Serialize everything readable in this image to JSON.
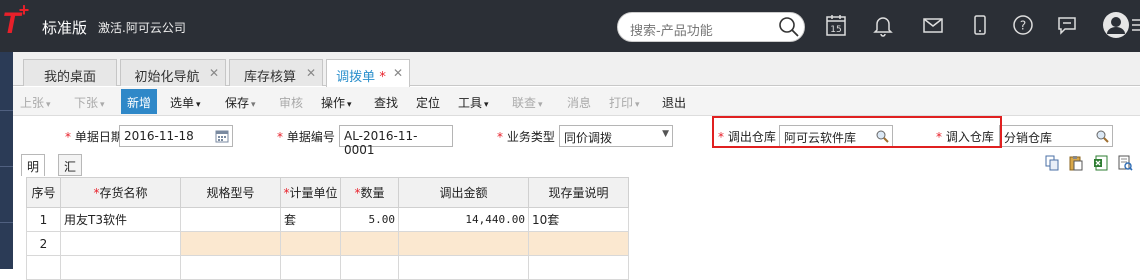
{
  "header": {
    "logo": "T",
    "logo_plus": "+",
    "edition": "标准版",
    "company": "激活.阿可云公司",
    "search_placeholder": "搜索-产品功能",
    "calendar_day": "15"
  },
  "tabs": [
    {
      "label": "我的桌面",
      "closable": false
    },
    {
      "label": "初始化导航",
      "closable": true
    },
    {
      "label": "库存核算",
      "closable": true
    },
    {
      "label": "调拨单",
      "closable": true,
      "modified": "*",
      "active": true
    }
  ],
  "toolbar": {
    "prev": "上张",
    "next": "下张",
    "new": "新增",
    "select": "选单",
    "save": "保存",
    "audit": "审核",
    "operate": "操作",
    "find": "查找",
    "locate": "定位",
    "tools": "工具",
    "link": "联查",
    "message": "消息",
    "print": "打印",
    "exit": "退出"
  },
  "form": {
    "date_label": "单据日期",
    "date_value": "2016-11-18",
    "number_label": "单据编号",
    "number_value": "AL-2016-11-0001",
    "biz_label": "业务类型",
    "biz_value": "同价调拨",
    "out_wh_label": "调出仓库",
    "out_wh_value": "阿可云软件库",
    "in_wh_label": "调入仓库",
    "in_wh_value": "分销仓库",
    "required_mark": "*"
  },
  "subtabs": {
    "detail": "明细",
    "summary": "汇总"
  },
  "grid": {
    "headers": {
      "seq": "序号",
      "item": "存货名称",
      "spec": "规格型号",
      "unit": "计量单位",
      "qty": "数量",
      "amount": "调出金额",
      "stock": "现存量说明"
    },
    "rows": [
      {
        "seq": "1",
        "item": "用友T3软件",
        "spec": "",
        "unit": "套",
        "qty": "5.00",
        "amount": "14,440.00",
        "stock": "10套"
      },
      {
        "seq": "2",
        "item": "",
        "spec": "",
        "unit": "",
        "qty": "",
        "amount": "",
        "stock": ""
      }
    ]
  },
  "colors": {
    "accent": "#2f88c8",
    "brand_red": "#e8202a",
    "topbar": "#2b2f36",
    "highlight_box": "#e02020"
  }
}
